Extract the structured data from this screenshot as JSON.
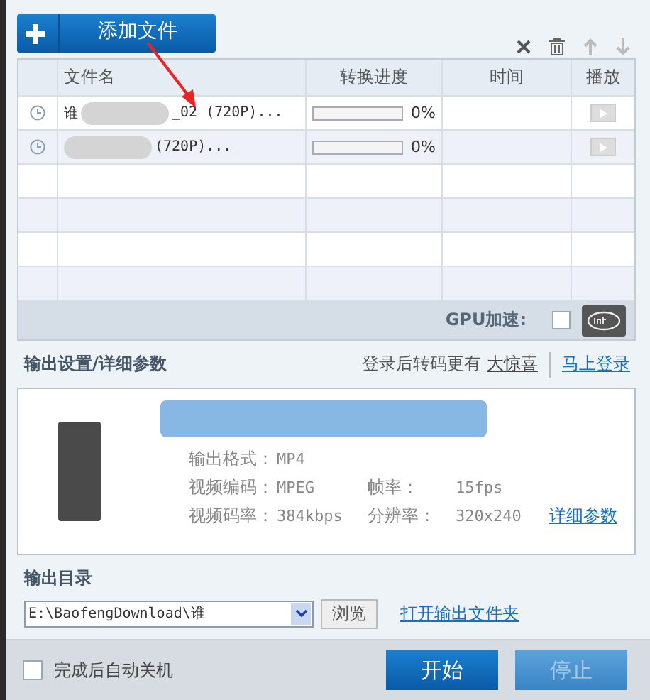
{
  "toolbar": {
    "add_button": "添加文件"
  },
  "table": {
    "columns": [
      "文件名",
      "转换进度",
      "时间",
      "播放"
    ],
    "rows": [
      {
        "name": "谁",
        "name_tail": "_02 (720P)...",
        "level": 0,
        "progress": "0%"
      },
      {
        "name": "",
        "name_tail": "(720P)...",
        "level": 0,
        "progress": "0%"
      }
    ],
    "gpu": {
      "label": "GPU加速:",
      "checked": false
    }
  },
  "output_settings": {
    "title": "输出设置/详细参数",
    "promo": "登录后转码更有",
    "promo_link": "大惊喜",
    "login_link": "马上登录",
    "params": [
      {
        "label": "输出格式：",
        "value": "MP4"
      },
      {
        "label": "视频编码：",
        "value": "MPEG"
      },
      {
        "label": "帧率：",
        "value": "15fps"
      },
      {
        "label": "视频码率：",
        "value": "384kbps"
      },
      {
        "label": "分辨率：",
        "value": "320x240"
      }
    ],
    "details_link": "详细参数"
  },
  "output_dir": {
    "title": "输出目录",
    "path": "E:\\BaofengDownload\\谁",
    "browse": "浏览",
    "open_folder": "打开输出文件夹"
  },
  "footer": {
    "shutdown": {
      "label": "完成后自动关机",
      "checked": false
    },
    "start": "开始",
    "stop": {
      "label": "停止",
      "disabled": true
    }
  }
}
